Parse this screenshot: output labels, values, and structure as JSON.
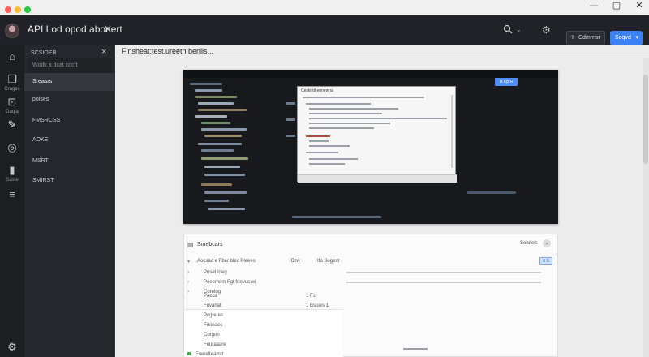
{
  "window": {
    "traffic_colors": [
      "#ff5f57",
      "#febc2e",
      "#28c840"
    ],
    "controls": [
      "—",
      "▢",
      "✕"
    ]
  },
  "header": {
    "title": "API Lod opod abodert",
    "close_glyph": "✕",
    "search_icon": "search-icon",
    "settings_icon": "gear-icon",
    "secondary_button": "Cdmrnsr",
    "primary_button": "Soqvd",
    "accent": "#3b82f6"
  },
  "rail": {
    "items": [
      {
        "icon": "home-icon",
        "glyph": "⌂",
        "label": ""
      },
      {
        "icon": "pages-icon",
        "glyph": "❐",
        "label": "Crages"
      },
      {
        "icon": "docs-icon",
        "glyph": "⊡",
        "label": "Daqia"
      },
      {
        "icon": "edit-icon",
        "glyph": "✎",
        "label": ""
      },
      {
        "icon": "target-icon",
        "glyph": "◎",
        "label": ""
      },
      {
        "icon": "chart-icon",
        "glyph": "▮",
        "label": "Susfe"
      },
      {
        "icon": "list-icon",
        "glyph": "≡",
        "label": ""
      },
      {
        "icon": "settings-icon",
        "glyph": "⚙",
        "label": ""
      }
    ]
  },
  "panel": {
    "heading": "SCSIOER",
    "search_placeholder": "Wodk a dcat cdcft",
    "items": [
      "Sreasrs",
      "poises",
      "FMSRCSS",
      "AOKE",
      "MSRT",
      "SMIRST"
    ],
    "active_index": 0
  },
  "main": {
    "label": "Finsheat:test.ureeth beniis...",
    "preview": {
      "chip": "R Kp R",
      "dialog_title": "Ceskrstl eonewna"
    },
    "card": {
      "title": "Smebcars",
      "right_label": "Sehnels",
      "tag": "0 S",
      "mid_a": "Drw",
      "mid_b": "Ito Sogest",
      "tree": [
        "Aocsad e Fber blec Pleees",
        "Puset Ideg",
        "Poeemem Fgf fonvuc wi",
        "Corelog",
        "Pacca",
        "Fuvanat",
        "Pcgreres",
        "Fuonaes",
        "Corgon",
        "Fuuraaare",
        "Fuereltearnd"
      ],
      "popup_a": "1 Fsr",
      "popup_b": "1 Bsiues 1"
    }
  }
}
